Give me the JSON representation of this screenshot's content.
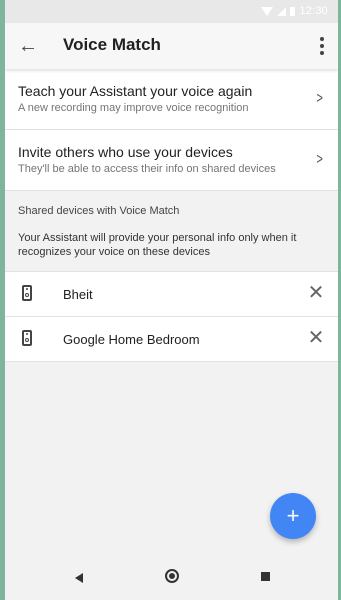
{
  "status_bar": {
    "time": "12:30"
  },
  "app_bar": {
    "back_icon": "arrow-back-icon",
    "title": "Voice Match",
    "menu_icon": "more-vert-icon"
  },
  "options": [
    {
      "title": "Teach your Assistant your voice again",
      "subtitle": "A new recording may improve voice recognition",
      "icon": "chevron-right-icon"
    },
    {
      "title": "Invite others who use your devices",
      "subtitle": "They'll be able to access their info on shared devices",
      "icon": "chevron-right-icon"
    }
  ],
  "shared_section": {
    "heading": "Shared devices with Voice Match",
    "description": "Your Assistant will provide your personal info only when it recognizes your voice on these devices"
  },
  "devices": [
    {
      "name": "Bheit",
      "icon": "speaker-icon",
      "remove_icon": "close-icon"
    },
    {
      "name": "Google Home Bedroom",
      "icon": "speaker-icon",
      "remove_icon": "close-icon"
    }
  ],
  "fab": {
    "label": "+",
    "icon": "add-icon"
  },
  "colors": {
    "accent": "#4285f4"
  }
}
